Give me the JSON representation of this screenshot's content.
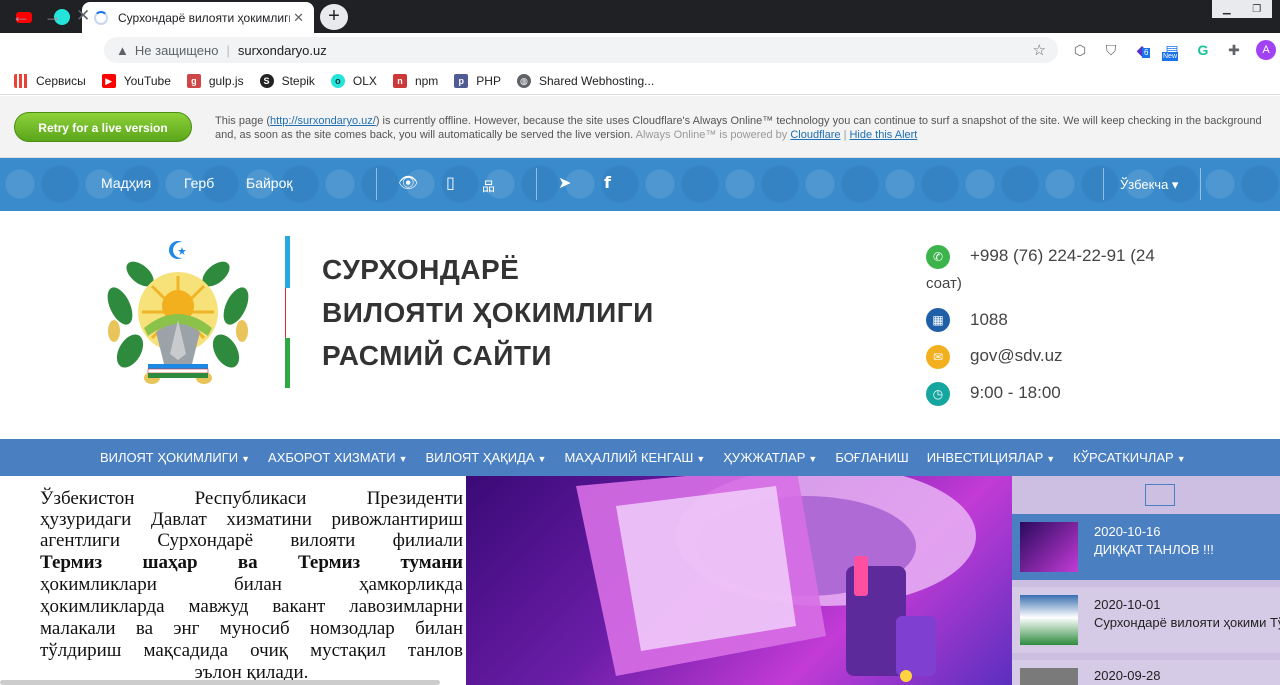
{
  "browser": {
    "tab_title": "Сурхондарё вилояти ҳокимлиги",
    "new_tab_label": "+",
    "close_label": "✕",
    "omnibox": {
      "security": "Не защищено",
      "url": "surxondaryo.uz"
    },
    "ext_badges": {
      "six": "6",
      "new": "New"
    },
    "profile": "A"
  },
  "bookmarks": [
    {
      "label": "Сервисы",
      "icon": "apps-icon"
    },
    {
      "label": "YouTube",
      "icon": "youtube-icon"
    },
    {
      "label": "gulp.js",
      "icon": "gulp-icon"
    },
    {
      "label": "Stepik",
      "icon": "stepik-icon"
    },
    {
      "label": "OLX",
      "icon": "olx-icon"
    },
    {
      "label": "npm",
      "icon": "npm-icon"
    },
    {
      "label": "PHP",
      "icon": "php-icon"
    },
    {
      "label": "Shared Webhosting...",
      "icon": "globe-icon"
    }
  ],
  "cloudflare": {
    "button": "Retry for a live version",
    "text_1": "This page (",
    "link_1": "http://surxondaryo.uz/",
    "text_2": ") is currently offline. However, because the site uses Cloudflare's Always Online™ technology you can continue to surf a snapshot of the site. We will keep checking in the background and, as soon as the site comes back, you will automatically be served the live version.",
    "text_3": "Always Online™ is powered by",
    "link_2": "Cloudflare",
    "divider": "|",
    "link_3": "Hide this Alert"
  },
  "top_nav": {
    "links": [
      "Мадҳия",
      "Герб",
      "Байроқ"
    ],
    "language": "Ўзбекча ▾"
  },
  "site": {
    "title_lines": [
      "СУРХОНДАРЁ",
      "ВИЛОЯТИ ҲОКИМЛИГИ",
      "РАСМИЙ САЙТИ"
    ],
    "contacts": {
      "phone": "+998 (76) 224-22-91 (24",
      "phone_cont": "соат)",
      "hotline": "1088",
      "email": "gov@sdv.uz",
      "hours": "9:00 - 18:00"
    }
  },
  "main_nav": [
    "ВИЛОЯТ ҲОКИМЛИГИ",
    "АХБОРОТ ХИЗМАТИ",
    "ВИЛОЯТ ҲАҚИДА",
    "МАҲАЛЛИЙ КЕНГАШ",
    "ҲУЖЖАТЛАР",
    "БОҒЛАНИШ",
    "ИНВЕСТИЦИЯЛАР",
    "КЎРСАТКИЧЛАР"
  ],
  "announcement_lines": [
    "Ўзбекистон Республикаси Президенти",
    "ҳузуридаги Давлат хизматини ривожлантириш",
    "агентлиги Сурхондарё вилояти филиали",
    "Термиз шаҳар ва Термиз тумани",
    "ҳокимликлари билан ҳамкорликда",
    "ҳокимликларда мавжуд вакант лавозимларни",
    "малакали ва энг муносиб номзодлар билан",
    "тўлдириш мақсадида очиқ мустақил танлов",
    "эълон қилади."
  ],
  "news": [
    {
      "date": "2020-10-16",
      "title": "ДИҚҚАТ ТАНЛОВ !!!"
    },
    {
      "date": "2020-10-01",
      "title": "Сурхондарё вилояти ҳокими Тўра Боболовнинг ўқитувчи ва"
    },
    {
      "date": "2020-09-28",
      "title": ""
    }
  ],
  "colors": {
    "accent": "#3a8bcb",
    "nav": "#4a7fc1",
    "cf_green": "#5aa61a"
  }
}
